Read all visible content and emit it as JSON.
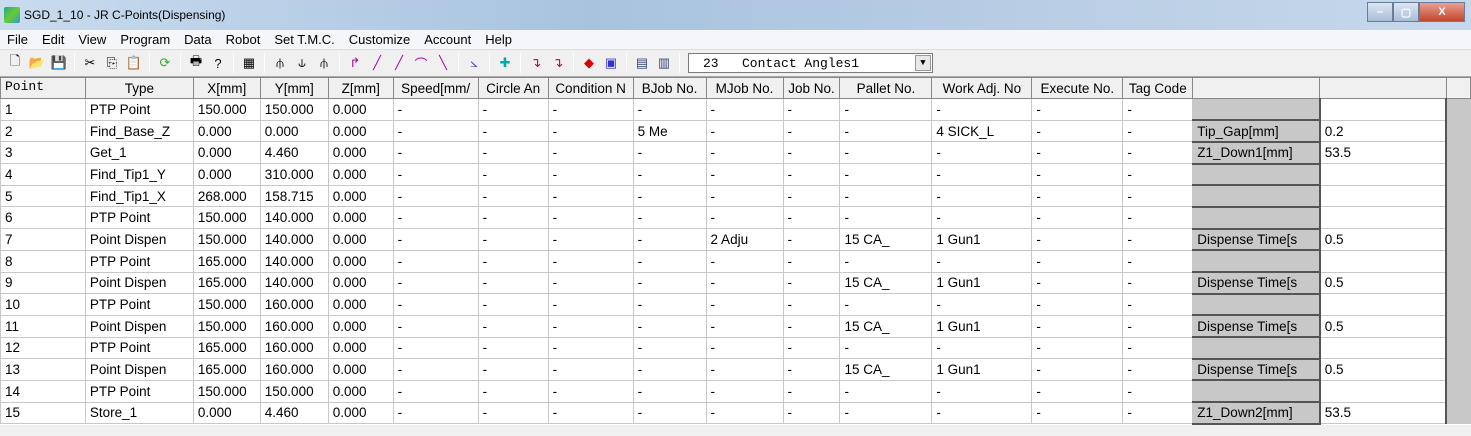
{
  "window": {
    "title": "SGD_1_10 - JR C-Points(Dispensing)",
    "min": "–",
    "max": "▢",
    "close": "X"
  },
  "menu": [
    "File",
    "Edit",
    "View",
    "Program",
    "Data",
    "Robot",
    "Set T.M.C.",
    "Customize",
    "Account",
    "Help"
  ],
  "toolbar": {
    "combo_value": "23   Contact Angles1"
  },
  "columns": [
    "Point",
    "Type",
    "X[mm]",
    "Y[mm]",
    "Z[mm]",
    "Speed[mm/",
    "Circle An",
    "Condition N",
    "BJob No.",
    "MJob No.",
    "Job No.",
    "Pallet No.",
    "Work Adj. No",
    "Execute No.",
    "Tag Code",
    "",
    ""
  ],
  "rows": [
    [
      "1",
      "PTP Point",
      "150.000",
      "150.000",
      "0.000",
      "-",
      "-",
      "-",
      "-",
      "-",
      "-",
      "-",
      "-",
      "-",
      "-",
      "",
      ""
    ],
    [
      "2",
      "Find_Base_Z",
      "0.000",
      "0.000",
      "0.000",
      "-",
      "-",
      "-",
      "5  Me",
      "-",
      "-",
      "-",
      "4  SICK_L",
      "-",
      "-",
      "Tip_Gap[mm]",
      "0.2"
    ],
    [
      "3",
      "Get_1",
      "0.000",
      "4.460",
      "0.000",
      "-",
      "-",
      "-",
      "-",
      "-",
      "-",
      "-",
      "-",
      "-",
      "-",
      "Z1_Down1[mm]",
      "53.5"
    ],
    [
      "4",
      "Find_Tip1_Y",
      "0.000",
      "310.000",
      "0.000",
      "-",
      "-",
      "-",
      "-",
      "-",
      "-",
      "-",
      "-",
      "-",
      "-",
      "",
      ""
    ],
    [
      "5",
      "Find_Tip1_X",
      "268.000",
      "158.715",
      "0.000",
      "-",
      "-",
      "-",
      "-",
      "-",
      "-",
      "-",
      "-",
      "-",
      "-",
      "",
      ""
    ],
    [
      "6",
      "PTP Point",
      "150.000",
      "140.000",
      "0.000",
      "-",
      "-",
      "-",
      "-",
      "-",
      "-",
      "-",
      "-",
      "-",
      "-",
      "",
      ""
    ],
    [
      "7",
      "Point Dispen",
      "150.000",
      "140.000",
      "0.000",
      "-",
      "-",
      "-",
      "-",
      "2  Adju",
      "-",
      "15  CA_",
      "1  Gun1",
      "-",
      "-",
      "Dispense Time[s",
      "0.5"
    ],
    [
      "8",
      "PTP Point",
      "165.000",
      "140.000",
      "0.000",
      "-",
      "-",
      "-",
      "-",
      "-",
      "-",
      "-",
      "-",
      "-",
      "-",
      "",
      ""
    ],
    [
      "9",
      "Point Dispen",
      "165.000",
      "140.000",
      "0.000",
      "-",
      "-",
      "-",
      "-",
      "-",
      "-",
      "15  CA_",
      "1  Gun1",
      "-",
      "-",
      "Dispense Time[s",
      "0.5"
    ],
    [
      "10",
      "PTP Point",
      "150.000",
      "160.000",
      "0.000",
      "-",
      "-",
      "-",
      "-",
      "-",
      "-",
      "-",
      "-",
      "-",
      "-",
      "",
      ""
    ],
    [
      "11",
      "Point Dispen",
      "150.000",
      "160.000",
      "0.000",
      "-",
      "-",
      "-",
      "-",
      "-",
      "-",
      "15  CA_",
      "1  Gun1",
      "-",
      "-",
      "Dispense Time[s",
      "0.5"
    ],
    [
      "12",
      "PTP Point",
      "165.000",
      "160.000",
      "0.000",
      "-",
      "-",
      "-",
      "-",
      "-",
      "-",
      "-",
      "-",
      "-",
      "-",
      "",
      ""
    ],
    [
      "13",
      "Point Dispen",
      "165.000",
      "160.000",
      "0.000",
      "-",
      "-",
      "-",
      "-",
      "-",
      "-",
      "15  CA_",
      "1  Gun1",
      "-",
      "-",
      "Dispense Time[s",
      "0.5"
    ],
    [
      "14",
      "PTP Point",
      "150.000",
      "150.000",
      "0.000",
      "-",
      "-",
      "-",
      "-",
      "-",
      "-",
      "-",
      "-",
      "-",
      "-",
      "",
      ""
    ],
    [
      "15",
      "Store_1",
      "0.000",
      "4.460",
      "0.000",
      "-",
      "-",
      "-",
      "-",
      "-",
      "-",
      "-",
      "-",
      "-",
      "-",
      "Z1_Down2[mm]",
      "53.5"
    ]
  ]
}
